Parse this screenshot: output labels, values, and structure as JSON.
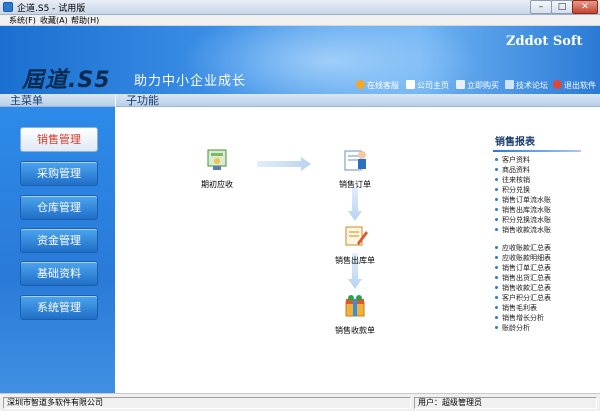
{
  "window": {
    "title": "企道.S5 - 试用版",
    "min": "–",
    "max": "□",
    "close": "✕"
  },
  "menu": [
    "系统(F)",
    "收藏(A)",
    "帮助(H)"
  ],
  "banner": {
    "brand": "Zddot Soft",
    "logo": "屆道.S5",
    "slogan": "助力中小企业成长",
    "links": [
      {
        "label": "在线客服",
        "icon": "service-icon"
      },
      {
        "label": "公司主页",
        "icon": "home-icon"
      },
      {
        "label": "立即购买",
        "icon": "cart-icon"
      },
      {
        "label": "技术论坛",
        "icon": "forum-icon"
      },
      {
        "label": "退出软件",
        "icon": "exit-icon"
      }
    ]
  },
  "headers": {
    "main_menu": "主菜单",
    "sub_function": "子功能"
  },
  "nav": [
    "销售管理",
    "采购管理",
    "仓库管理",
    "资金管理",
    "基础资料",
    "系统管理"
  ],
  "nav_active": "销售管理",
  "flow": {
    "initial_receivable": "期初应收",
    "sales_order": "销售订单",
    "sales_outbound": "销售出库单",
    "sales_receipt": "销售收款单"
  },
  "report": {
    "title": "销售报表",
    "group1": [
      "客户资料",
      "商品资料",
      "往来核销",
      "积分兑换",
      "销售订单流水账",
      "销售出库流水账",
      "积分兑换流水账",
      "销售收款流水账"
    ],
    "group2": [
      "应收账款汇总表",
      "应收账款明细表",
      "销售订单汇总表",
      "销售出货汇总表",
      "销售收款汇总表",
      "客户积分汇总表",
      "销售毛利表",
      "销售增长分析",
      "账龄分析"
    ]
  },
  "status": {
    "company": "深圳市智道多软件有限公司",
    "user": "用户：超级管理员"
  },
  "colors": {
    "banner": "#2a7ad8",
    "sidebar": "#2a7ad8",
    "active_text": "#d8392a"
  }
}
